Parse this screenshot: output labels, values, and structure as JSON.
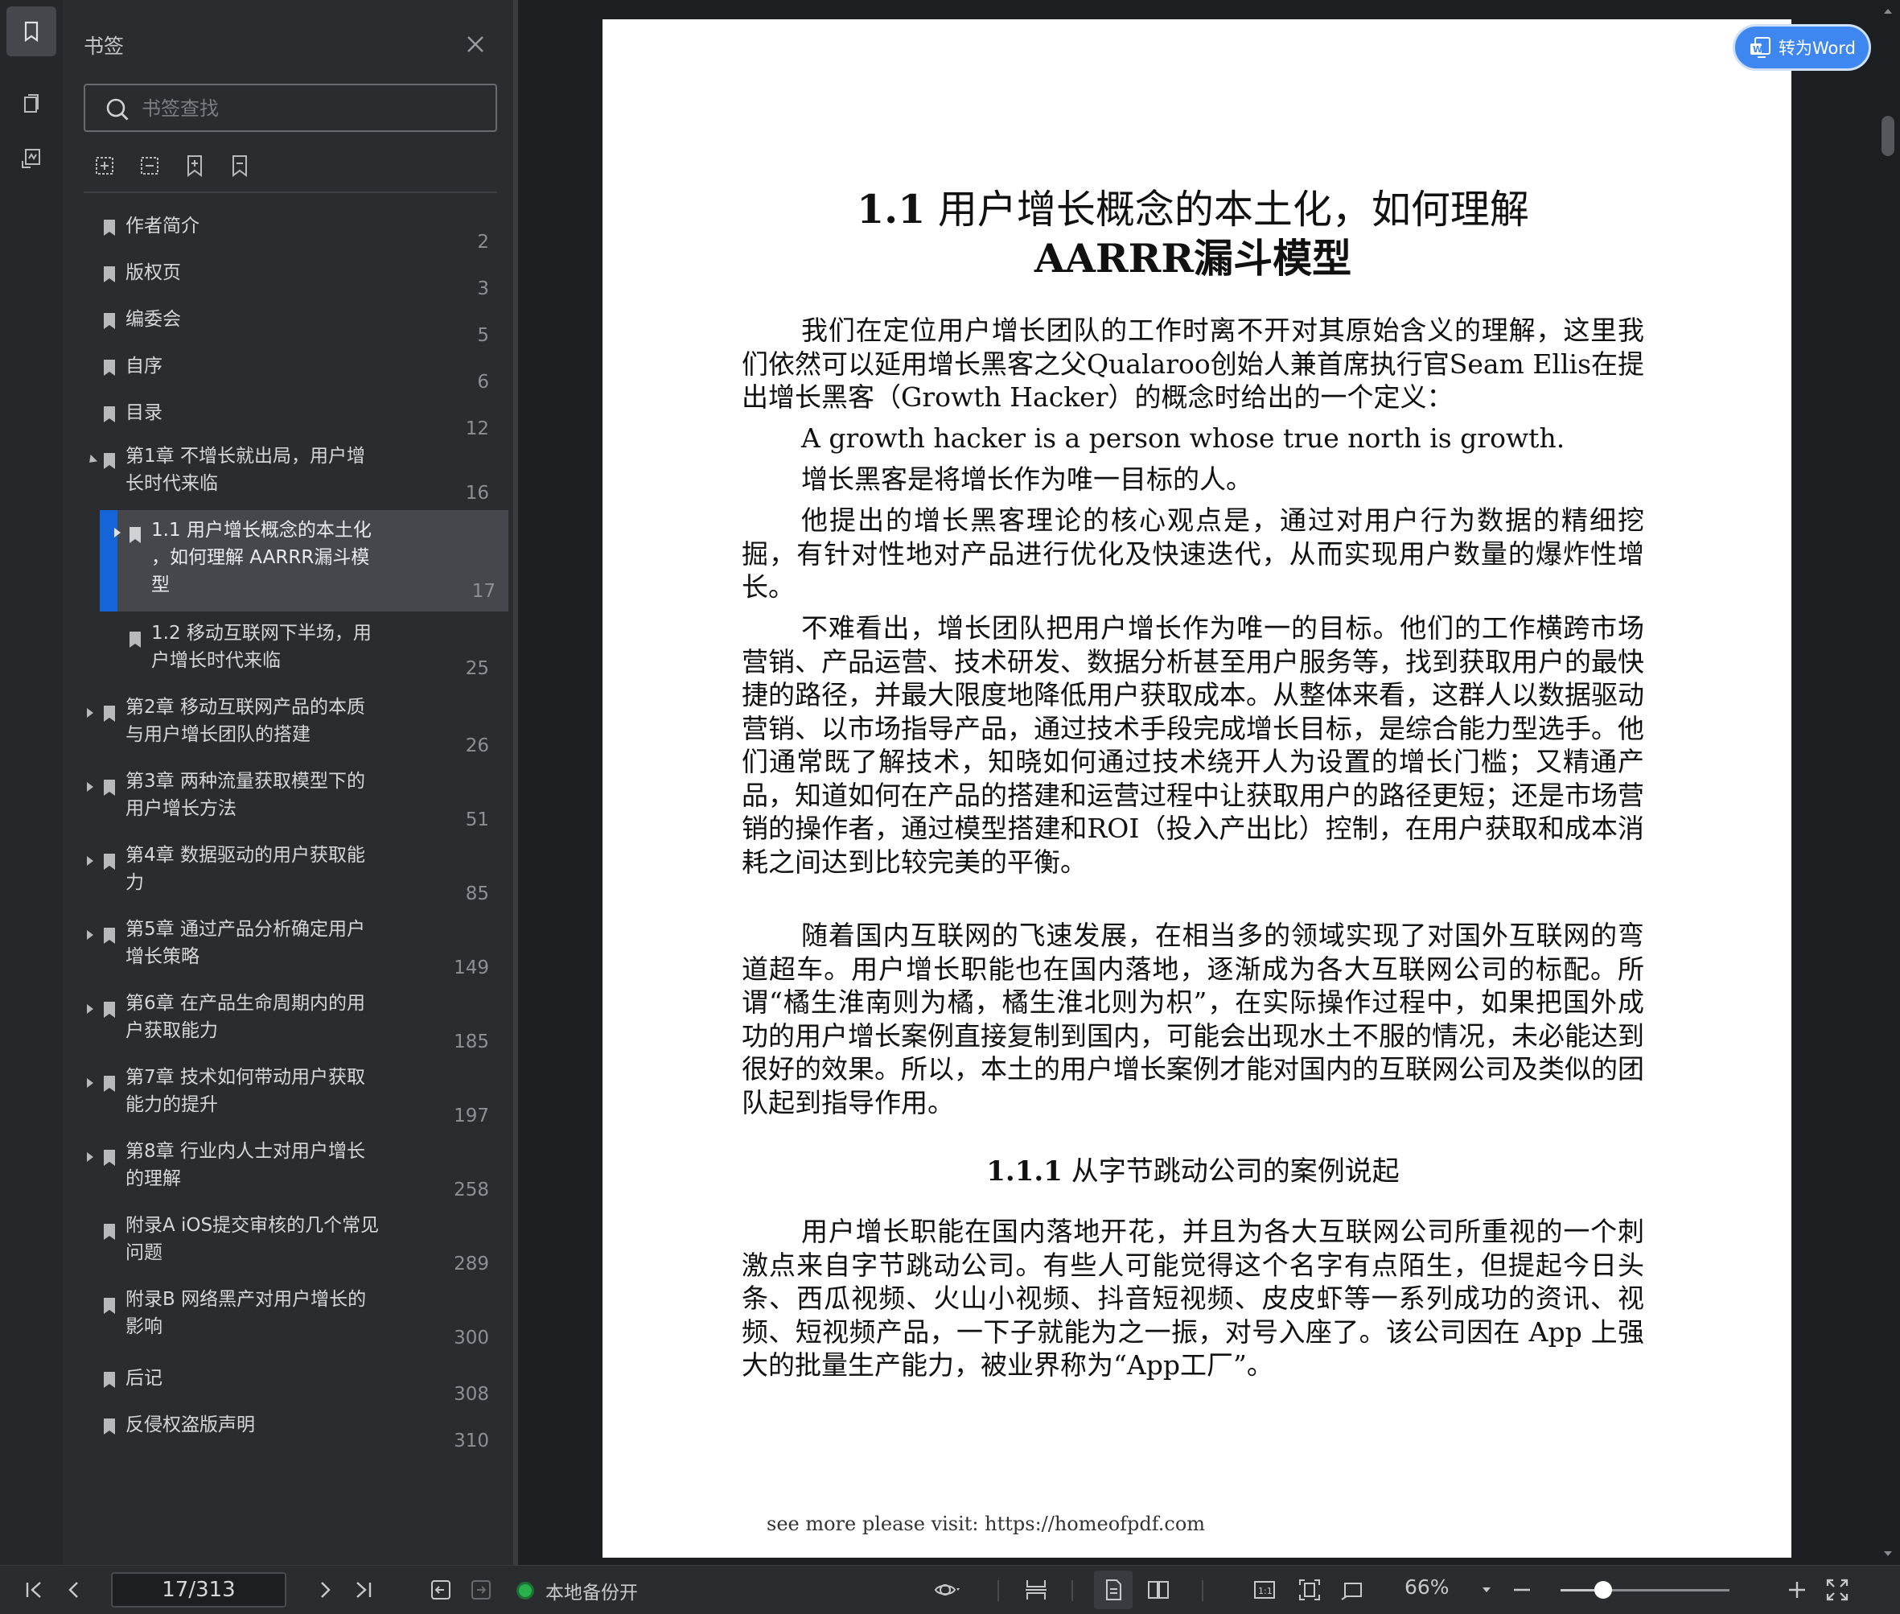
{
  "panel": {
    "title": "书签",
    "search_placeholder": "书签查找"
  },
  "bookmarks": [
    {
      "label": "作者简介",
      "page": "2"
    },
    {
      "label": "版权页",
      "page": "3"
    },
    {
      "label": "编委会",
      "page": "5"
    },
    {
      "label": "自序",
      "page": "6"
    },
    {
      "label": "目录",
      "page": "12"
    },
    {
      "label": "第1章 不增长就出局，用户增\n长时代来临",
      "page": "16"
    },
    {
      "label": "1.1 用户增长概念的本土化\n，如何理解 AARRR漏斗模\n型",
      "page": "17"
    },
    {
      "label": "1.2 移动互联网下半场，用\n户增长时代来临",
      "page": "25"
    },
    {
      "label": "第2章 移动互联网产品的本质\n与用户增长团队的搭建",
      "page": "26"
    },
    {
      "label": "第3章 两种流量获取模型下的\n用户增长方法",
      "page": "51"
    },
    {
      "label": "第4章 数据驱动的用户获取能\n力",
      "page": "85"
    },
    {
      "label": "第5章 通过产品分析确定用户\n增长策略",
      "page": "149"
    },
    {
      "label": "第6章 在产品生命周期内的用\n户获取能力",
      "page": "185"
    },
    {
      "label": "第7章 技术如何带动用户获取\n能力的提升",
      "page": "197"
    },
    {
      "label": "第8章 行业内人士对用户增长\n的理解",
      "page": "258"
    },
    {
      "label": "附录A iOS提交审核的几个常见\n问题",
      "page": "289"
    },
    {
      "label": "附录B 网络黑产对用户增长的\n影响",
      "page": "300"
    },
    {
      "label": "后记",
      "page": "308"
    },
    {
      "label": "反侵权盗版声明",
      "page": "310"
    }
  ],
  "document": {
    "title_num": "1.1",
    "title_line1": "用户增长概念的本土化，如何理解",
    "title_line2": "AARRR漏斗模型",
    "p1": "我们在定位用户增长团队的工作时离不开对其原始含义的理解，这里我们依然可以延用增长黑客之父Qualaroo创始人兼首席执行官Seam Ellis在提出增长黑客（Growth Hacker）的概念时给出的一个定义：",
    "quote_en": "A growth hacker is a person whose true north is growth.",
    "quote_cn": "增长黑客是将增长作为唯一目标的人。",
    "p2": "他提出的增长黑客理论的核心观点是，通过对用户行为数据的精细挖掘，有针对性地对产品进行优化及快速迭代，从而实现用户数量的爆炸性增长。",
    "p3": "不难看出，增长团队把用户增长作为唯一的目标。他们的工作横跨市场营销、产品运营、技术研发、数据分析甚至用户服务等，找到获取用户的最快捷的路径，并最大限度地降低用户获取成本。从整体来看，这群人以数据驱动营销、以市场指导产品，通过技术手段完成增长目标，是综合能力型选手。他们通常既了解技术，知晓如何通过技术绕开人为设置的增长门槛；又精通产品，知道如何在产品的搭建和运营过程中让获取用户的路径更短；还是市场营销的操作者，通过模型搭建和ROI（投入产出比）控制，在用户获取和成本消耗之间达到比较完美的平衡。",
    "p4": "随着国内互联网的飞速发展，在相当多的领域实现了对国外互联网的弯道超车。用户增长职能也在国内落地，逐渐成为各大互联网公司的标配。所谓“橘生淮南则为橘，橘生淮北则为枳”，在实际操作过程中，如果把国外成功的用户增长案例直接复制到国内，可能会出现水土不服的情况，未必能达到很好的效果。所以，本土的用户增长案例才能对国内的互联网公司及类似的团队起到指导作用。",
    "h2_num": "1.1.1",
    "h2_text": "从字节跳动公司的案例说起",
    "p5": "用户增长职能在国内落地开花，并且为各大互联网公司所重视的一个刺激点来自字节跳动公司。有些人可能觉得这个名字有点陌生，但提起今日头条、西瓜视频、火山小视频、抖音短视频、皮皮虾等一系列成功的资讯、视频、短视频产品，一下子就能为之一振，对号入座了。该公司因在 App 上强大的批量生产能力，被业界称为“App工厂”。",
    "footer": "see more please visit: https://homeofpdf.com"
  },
  "convert_button": "转为Word",
  "bottombar": {
    "page_indicator": "17/313",
    "backup_label": "本地备份开",
    "zoom": "66%",
    "zoom_fraction": 0.25
  },
  "colors": {
    "accent": "#1565d8",
    "word_button": "#3e86f0",
    "backup_on": "#27b04b"
  }
}
